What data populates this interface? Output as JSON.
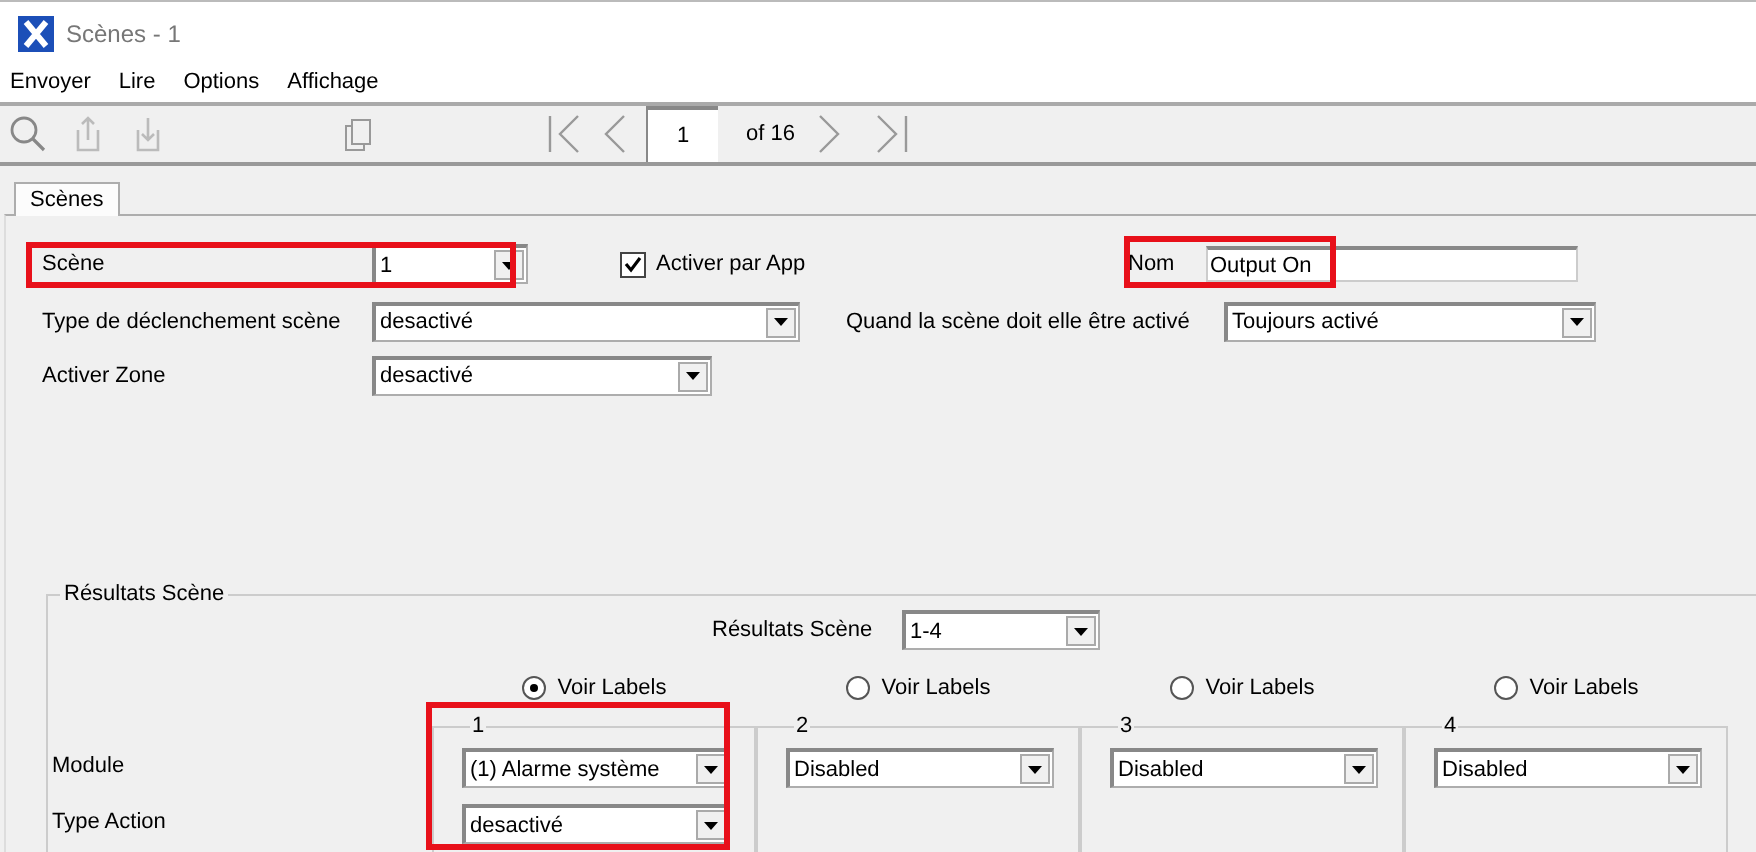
{
  "window": {
    "title": "Scènes - 1"
  },
  "menu": [
    "Envoyer",
    "Lire",
    "Options",
    "Affichage"
  ],
  "pager": {
    "page": "1",
    "of": "of 16"
  },
  "tabs": [
    {
      "label": "Scènes",
      "selected": true
    }
  ],
  "form": {
    "scene": {
      "label": "Scène",
      "value": "1",
      "highlighted": true
    },
    "activer_par_app": {
      "label": "Activer par App",
      "checked": true
    },
    "nom": {
      "label": "Nom",
      "value": "Output On",
      "highlighted": true
    },
    "type_declenchement": {
      "label": "Type de déclenchement scène",
      "value": "desactivé"
    },
    "quand": {
      "label": "Quand la scène doit elle être activé",
      "value": "Toujours activé"
    },
    "activer_zone": {
      "label": "Activer Zone",
      "value": "desactivé"
    }
  },
  "results": {
    "title": "Résultats Scène",
    "range_label": "Résultats Scène",
    "range": "1-4",
    "row_labels": [
      "Module",
      "Type Action"
    ],
    "groups": [
      {
        "number": "1",
        "radio_label": "Voir Labels",
        "selected": true,
        "highlighted": true,
        "module": "(1) Alarme système",
        "action": "desactivé"
      },
      {
        "number": "2",
        "radio_label": "Voir Labels",
        "selected": false,
        "highlighted": false,
        "module": "Disabled"
      },
      {
        "number": "3",
        "radio_label": "Voir Labels",
        "selected": false,
        "highlighted": false,
        "module": "Disabled"
      },
      {
        "number": "4",
        "radio_label": "Voir Labels",
        "selected": false,
        "highlighted": false,
        "module": "Disabled"
      }
    ]
  }
}
